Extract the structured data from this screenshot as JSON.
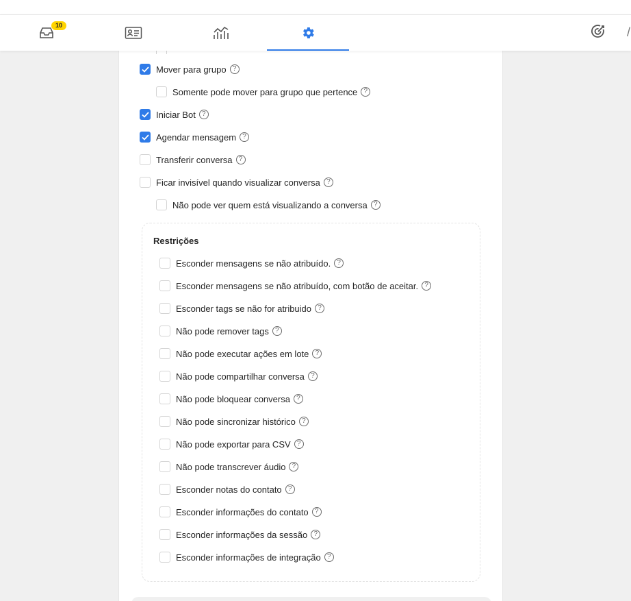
{
  "nav": {
    "inbox_badge": "10",
    "items": [
      {
        "icon": "inbox-icon"
      },
      {
        "icon": "contact-card-icon"
      },
      {
        "icon": "analytics-chart-icon"
      },
      {
        "icon": "gear-icon",
        "active": true
      }
    ],
    "right_icon": "target-icon"
  },
  "permissions": [
    {
      "label": "Mover para grupo",
      "checked": true,
      "indent": 0
    },
    {
      "label": "Somente pode mover para grupo que pertence",
      "checked": false,
      "indent": 1
    },
    {
      "label": "Iniciar Bot",
      "checked": true,
      "indent": 0
    },
    {
      "label": "Agendar mensagem",
      "checked": true,
      "indent": 0
    },
    {
      "label": "Transferir conversa",
      "checked": false,
      "indent": 0
    },
    {
      "label": "Ficar invisível quando visualizar conversa",
      "checked": false,
      "indent": 0
    },
    {
      "label": "Não pode ver quem está visualizando a conversa",
      "checked": false,
      "indent": 1
    }
  ],
  "restrictions": {
    "title": "Restrições",
    "items": [
      {
        "label": "Esconder mensagens se não atribuído.",
        "checked": false
      },
      {
        "label": "Esconder mensagens se não atribuído, com botão de aceitar.",
        "checked": false
      },
      {
        "label": "Esconder tags se não for atribuido",
        "checked": false
      },
      {
        "label": "Não pode remover tags",
        "checked": false
      },
      {
        "label": "Não pode executar ações em lote",
        "checked": false
      },
      {
        "label": "Não pode compartilhar conversa",
        "checked": false
      },
      {
        "label": "Não pode bloquear conversa",
        "checked": false
      },
      {
        "label": "Não pode sincronizar histórico",
        "checked": false
      },
      {
        "label": "Não pode exportar para CSV",
        "checked": false
      },
      {
        "label": "Não pode transcrever áudio",
        "checked": false
      },
      {
        "label": "Esconder notas do contato",
        "checked": false
      },
      {
        "label": "Esconder informações do contato",
        "checked": false
      },
      {
        "label": "Esconder informações da sessão",
        "checked": false
      },
      {
        "label": "Esconder informações de integração",
        "checked": false
      }
    ]
  },
  "colors": {
    "accent": "#2f7be8",
    "badge": "#ffd400"
  }
}
